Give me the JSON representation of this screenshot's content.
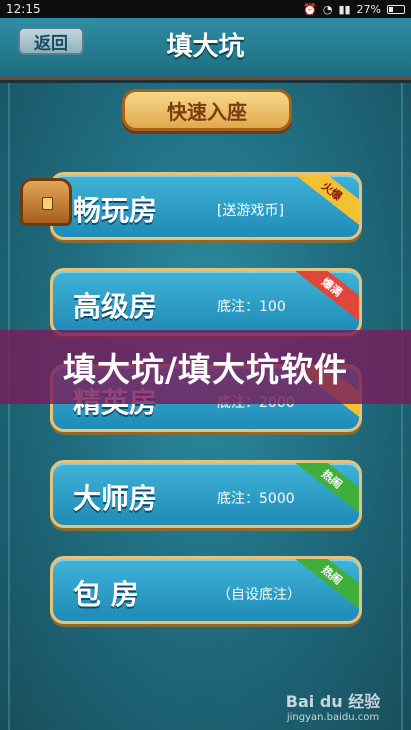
{
  "statusbar": {
    "time": "12:15",
    "battery": "27%"
  },
  "header": {
    "back_label": "返回",
    "title": "填大坑"
  },
  "quick_seat_label": "快速入座",
  "rooms": [
    {
      "name": "畅玩房",
      "sub": "[送游戏币]",
      "tag": "火爆",
      "tag_color": "#f2c230"
    },
    {
      "name": "高级房",
      "sub": "底注：100",
      "tag": "爆满",
      "tag_color": "#e0473a"
    },
    {
      "name": "精英房",
      "sub": "底注：2000",
      "tag": "",
      "tag_color": "#f2c230"
    },
    {
      "name": "大师房",
      "sub": "底注：5000",
      "tag": "热闹",
      "tag_color": "#3fae3a"
    },
    {
      "name": "包 房",
      "sub": "（自设底注）",
      "tag": "热闹",
      "tag_color": "#3fae3a"
    }
  ],
  "banner_text": "填大坑/填大坑软件",
  "watermark": {
    "logo": "Bai du 经验",
    "url": "jingyan.baidu.com"
  }
}
